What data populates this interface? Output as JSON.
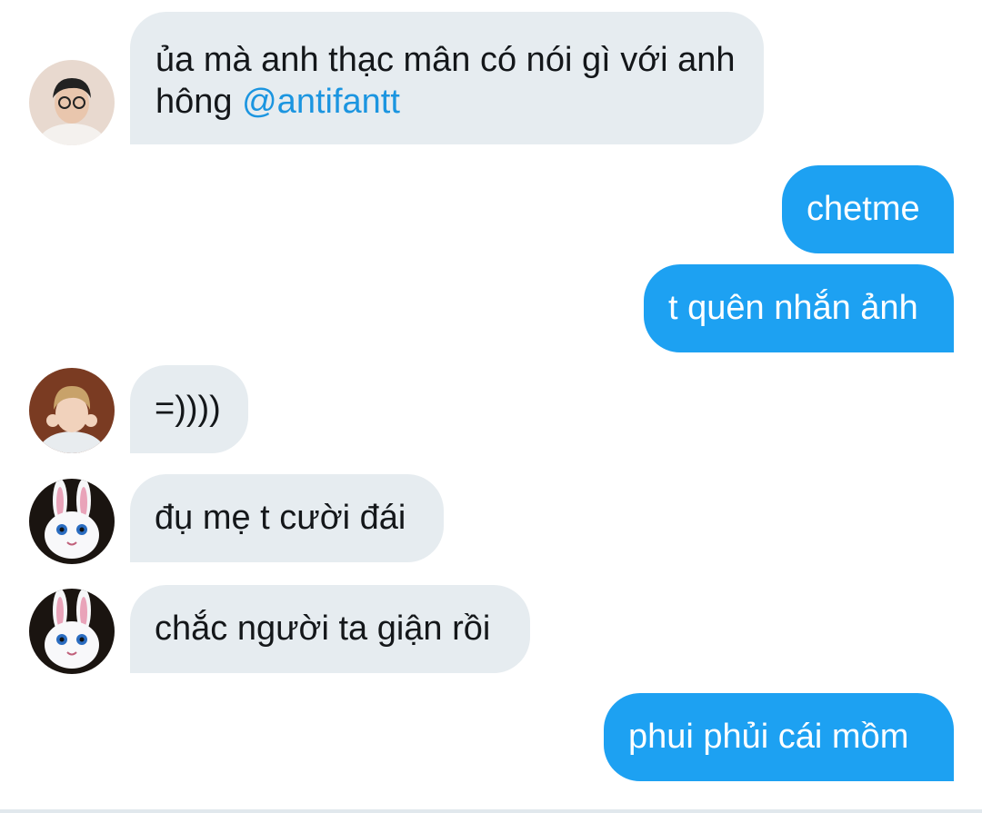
{
  "conversation": {
    "messages": [
      {
        "side": "incoming",
        "text_prefix": "ủa mà anh thạc mân có nói gì với anh hông",
        "mention": "@antifantt"
      },
      {
        "side": "outgoing",
        "text": "chetme"
      },
      {
        "side": "outgoing",
        "text": "t quên nhắn ảnh"
      },
      {
        "side": "incoming",
        "text": "=))))"
      },
      {
        "side": "incoming",
        "text": "đụ mẹ t cười đái"
      },
      {
        "side": "incoming",
        "text": "chắc người ta giận rồi"
      },
      {
        "side": "outgoing",
        "text": "phui phủi cái mồm"
      }
    ]
  },
  "colors": {
    "incoming_bubble": "#e6ecf0",
    "outgoing_bubble": "#1da1f2",
    "mention": "#1b95e0",
    "text": "#14171a"
  }
}
